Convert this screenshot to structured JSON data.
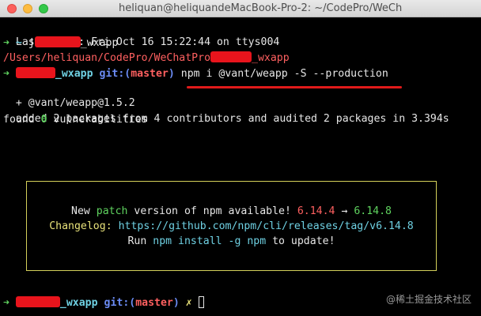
{
  "window": {
    "title": "heliquan@heliquandeMacBook-Pro-2: ~/CodePro/WeCh"
  },
  "terminal": {
    "last_login": "Last login: Fri Oct 16 15:22:44 on ttys004",
    "prompt_arrow": "➜",
    "home_dir": "~",
    "cmd1_prefix": "j",
    "cmd1_suffix": "_wxapp",
    "path_prefix": "/Users/heliquan/CodePro/WeChatPro",
    "path_suffix": "_wxapp",
    "dir_suffix": "_wxapp",
    "git_label": "git:",
    "branch_open": "(",
    "branch": "master",
    "branch_close": ")",
    "dirty_marker": "✗",
    "npm_command": "npm i @vant/weapp -S --production",
    "install_result": "+ @vant/weapp@1.5.2",
    "added_line": "added 2 packages from 4 contributors and audited 2 packages in 3.394s",
    "found_prefix": "found ",
    "vuln_count": "0",
    "found_suffix": " vulnerabilities"
  },
  "notice": {
    "new_text": "New ",
    "patch_word": "patch",
    "version_text": " version of npm available! ",
    "old_version": "6.14.4",
    "arrow": " → ",
    "new_version": "6.14.8",
    "changelog_label": "Changelog: ",
    "changelog_url": "https://github.com/npm/cli/releases/tag/v6.14.8",
    "run_text": "Run ",
    "install_cmd": "npm install -g npm",
    "update_text": " to update!"
  },
  "watermark": "@稀土掘金技术社区",
  "colors": {
    "prompt_green": "#5fd35f",
    "dir_cyan": "#6fd1e3",
    "git_blue": "#6b8cf5",
    "branch_red": "#ff6060",
    "notice_border": "#d4d05a",
    "redaction": "#e8141c"
  }
}
